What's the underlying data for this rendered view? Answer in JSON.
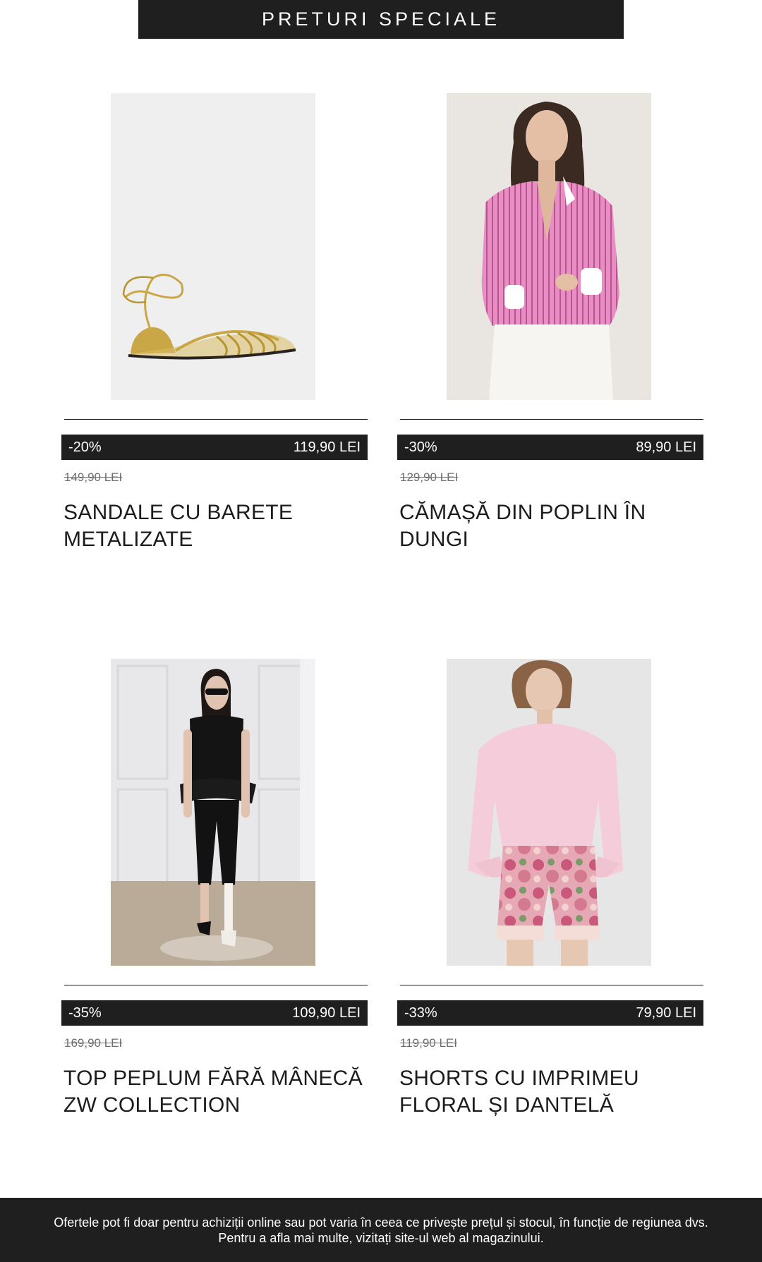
{
  "header": {
    "title": "PRETURI SPECIALE"
  },
  "products": [
    {
      "discount": "-20%",
      "price": "119,90 LEI",
      "old_price": "149,90 LEI",
      "title": "SANDALE CU BARETE METALIZATE",
      "image": "gold-lace-up-sandal"
    },
    {
      "discount": "-30%",
      "price": "89,90 LEI",
      "old_price": "129,90 LEI",
      "title": "CĂMAȘĂ DIN POPLIN ÎN DUNGI",
      "image": "model-pink-striped-shirt"
    },
    {
      "discount": "-35%",
      "price": "109,90 LEI",
      "old_price": "169,90 LEI",
      "title": "TOP PEPLUM FĂRĂ MÂNECĂ ZW COLLECTION",
      "image": "model-black-peplum-top"
    },
    {
      "discount": "-33%",
      "price": "79,90 LEI",
      "old_price": "119,90 LEI",
      "title": "SHORTS CU IMPRIMEU FLORAL ȘI DANTELĂ",
      "image": "model-pink-sweater-floral-shorts"
    }
  ],
  "footer": {
    "disclaimer": "Ofertele pot fi doar pentru achiziții online sau pot varia în ceea ce privește prețul și stocul, în funcție de regiunea dvs. Pentru a afla mai multe, vizitați site-ul web al magazinului."
  },
  "colors": {
    "bar": "#1f1f1f",
    "text": "#1c1c1c",
    "strike": "#6d6d6d"
  }
}
